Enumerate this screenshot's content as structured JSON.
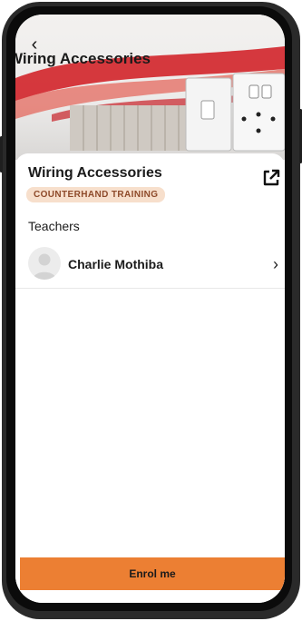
{
  "header": {
    "title": "Wiring Accessories",
    "back_icon": "chevron-left-icon"
  },
  "course": {
    "title": "Wiring Accessories",
    "tag": "COUNTERHAND TRAINING",
    "open_icon": "external-link-icon"
  },
  "teachers": {
    "label": "Teachers",
    "items": [
      {
        "name": "Charlie Mothiba"
      }
    ]
  },
  "actions": {
    "enrol_label": "Enrol me"
  },
  "colors": {
    "accent": "#ec7f33",
    "tag_bg": "#f7dfcc",
    "tag_text": "#8e4a2a",
    "hero_red": "#d2232a"
  }
}
